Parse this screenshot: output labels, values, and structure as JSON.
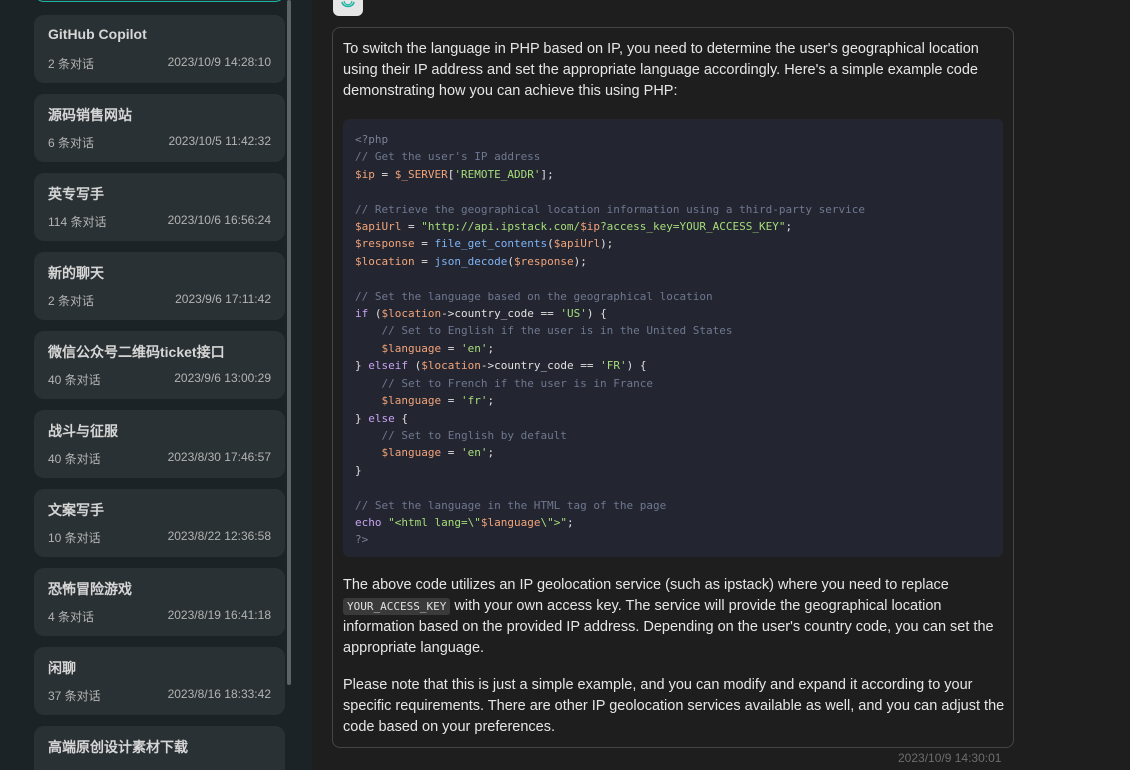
{
  "sidebar": {
    "chats": [
      {
        "title": "GitHub Copilot",
        "count": "2 条对话",
        "time": "2023/10/9 14:28:10"
      },
      {
        "title": "源码销售网站",
        "count": "6 条对话",
        "time": "2023/10/5 11:42:32"
      },
      {
        "title": "英专写手",
        "count": "114 条对话",
        "time": "2023/10/6 16:56:24"
      },
      {
        "title": "新的聊天",
        "count": "2 条对话",
        "time": "2023/9/6 17:11:42"
      },
      {
        "title": "微信公众号二维码ticket接口",
        "count": "40 条对话",
        "time": "2023/9/6 13:00:29"
      },
      {
        "title": "战斗与征服",
        "count": "40 条对话",
        "time": "2023/8/30 17:46:57"
      },
      {
        "title": "文案写手",
        "count": "10 条对话",
        "time": "2023/8/22 12:36:58"
      },
      {
        "title": "恐怖冒险游戏",
        "count": "4 条对话",
        "time": "2023/8/19 16:41:18"
      },
      {
        "title": "闲聊",
        "count": "37 条对话",
        "time": "2023/8/16 18:33:42"
      },
      {
        "title": "高端原创设计素材下载",
        "count": "",
        "time": ""
      }
    ]
  },
  "message": {
    "avatar_icon": "openai-logo-icon",
    "intro": "To switch the language in PHP based on IP, you need to determine the user's geographical location using their IP address and set the appropriate language accordingly. Here's a simple example code demonstrating how you can achieve this using PHP:",
    "para2_before": "The above code utilizes an IP geolocation service (such as ipstack) where you need to replace",
    "para2_code": "YOUR_ACCESS_KEY",
    "para2_after": "with your own access key. The service will provide the geographical location information based on the provided IP address. Depending on the user's country code, you can set the appropriate language.",
    "para3": "Please note that this is just a simple example, and you can modify and expand it according to your specific requirements. There are other IP geolocation services available as well, and you can adjust the code based on your preferences.",
    "timestamp": "2023/10/9 14:30:01",
    "code": {
      "open_tag": "<?php",
      "cmt1": "// Get the user's IP address",
      "l1_var": "$ip",
      "l1_eq": " = ",
      "l1_var2": "$_SERVER",
      "l1_b1": "[",
      "l1_str": "'REMOTE_ADDR'",
      "l1_b2": "];",
      "cmt2": "// Retrieve the geographical location information using a third-party service",
      "l2_var": "$apiUrl",
      "l2_eq": " = ",
      "l2_str1": "\"http://api.ipstack.com/",
      "l2_var2": "$ip",
      "l2_str2": "?access_key=YOUR_ACCESS_KEY\"",
      "l2_end": ";",
      "l3_var": "$response",
      "l3_eq": " = ",
      "l3_fn": "file_get_contents",
      "l3_p1": "(",
      "l3_var2": "$apiUrl",
      "l3_p2": ");",
      "l4_var": "$location",
      "l4_eq": " = ",
      "l4_fn": "json_decode",
      "l4_p1": "(",
      "l4_var2": "$response",
      "l4_p2": ");",
      "cmt3": "// Set the language based on the geographical location",
      "if_kw": "if",
      "if_p": " (",
      "if_var": "$location",
      "if_rest": "->country_code == ",
      "if_str": "'US'",
      "if_end": ") {",
      "cmt4": "// Set to English if the user is in the United States",
      "lang_var": "$language",
      "lang_eq": " = ",
      "en_str": "'en'",
      "semi": ";",
      "elseif_pre": "} ",
      "elseif_kw": "elseif",
      "elseif_p": " (",
      "elseif_var": "$location",
      "elseif_rest": "->country_code == ",
      "elseif_str": "'FR'",
      "elseif_end": ") {",
      "cmt5": "// Set to French if the user is in France",
      "fr_str": "'fr'",
      "else_pre": "} ",
      "else_kw": "else",
      "else_end": " {",
      "cmt6": "// Set to English by default",
      "close_brace": "}",
      "cmt7": "// Set the language in the HTML tag of the page",
      "echo_kw": "echo",
      "echo_str1": " \"<html lang=\\\"",
      "echo_var": "$language",
      "echo_str2": "\\\">\"",
      "close_tag": "?>"
    }
  }
}
